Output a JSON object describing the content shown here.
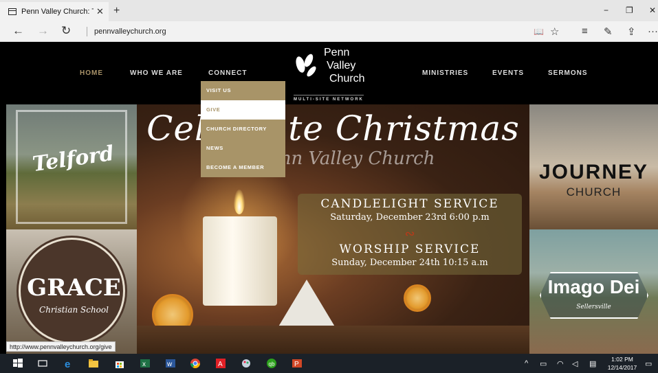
{
  "browser": {
    "tab_title": "Penn Valley Church: Telf",
    "tab_close": "✕",
    "new_tab": "+",
    "minimize": "−",
    "restore": "❐",
    "close": "✕",
    "back": "←",
    "forward": "→",
    "refresh": "↻",
    "url": "pennvalleychurch.org",
    "reading_view": "📖",
    "favorite": "☆",
    "hub": "≡",
    "notes": "✎",
    "share": "⇪",
    "more": "···"
  },
  "nav": {
    "home": "HOME",
    "who": "WHO WE ARE",
    "connect": "CONNECT",
    "ministries": "MINISTRIES",
    "events": "EVENTS",
    "sermons": "SERMONS"
  },
  "logo": {
    "line1": "Penn",
    "line2": "Valley",
    "line3": "Church",
    "sub": "MULTI-SITE NETWORK"
  },
  "dropdown": [
    {
      "label": "VISIT US"
    },
    {
      "label": "GIVE"
    },
    {
      "label": "CHURCH DIRECTORY"
    },
    {
      "label": "NEWS"
    },
    {
      "label": "BECOME A MEMBER"
    }
  ],
  "tiles": {
    "telford": "Telford",
    "grace_title": "GRACE",
    "grace_sub": "Christian School",
    "journey_title": "JOURNEY",
    "journey_sub": "CHURCH",
    "imago_title": "Imago Dei",
    "imago_sub": "Sellersville"
  },
  "banner": {
    "heading": "Celebrate Christmas",
    "subheading": "Penn Valley Church",
    "service1_title": "CANDLELIGHT SERVICE",
    "service1_time": "Saturday, December 23rd 6:00 p.m",
    "service2_title": "WORSHIP SERVICE",
    "service2_time": "Sunday, December 24th 10:15 a.m"
  },
  "status_url": "http://www.pennvalleychurch.org/give",
  "taskbar": {
    "time": "1:02 PM",
    "date": "12/14/2017"
  },
  "colors": {
    "accent": "#a89468",
    "nav_active": "#a89268",
    "taskbar": "#1b2128"
  }
}
